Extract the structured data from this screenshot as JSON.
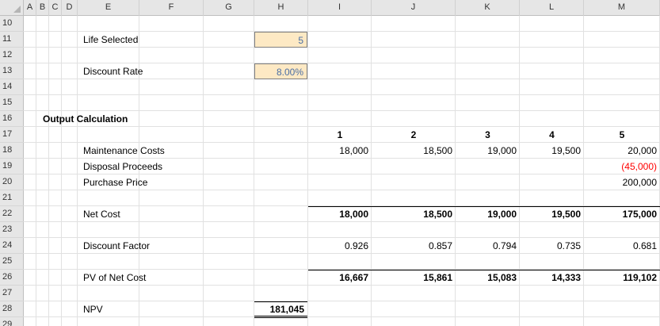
{
  "columns": [
    "A",
    "B",
    "C",
    "D",
    "E",
    "F",
    "G",
    "H",
    "I",
    "J",
    "K",
    "L",
    "M"
  ],
  "rows": [
    "10",
    "11",
    "12",
    "13",
    "14",
    "15",
    "16",
    "17",
    "18",
    "19",
    "20",
    "21",
    "22",
    "23",
    "24",
    "25",
    "26",
    "27",
    "28",
    "29"
  ],
  "inputs": {
    "life_label": "Life Selected",
    "life_value": "5",
    "rate_label": "Discount Rate",
    "rate_value": "8.00%"
  },
  "output": {
    "title": "Output Calculation",
    "years": [
      "1",
      "2",
      "3",
      "4",
      "5"
    ],
    "maintenance": {
      "label": "Maintenance Costs",
      "values": [
        "18,000",
        "18,500",
        "19,000",
        "19,500",
        "20,000"
      ]
    },
    "disposal": {
      "label": "Disposal Proceeds",
      "values": [
        "",
        "",
        "",
        "",
        "(45,000)"
      ]
    },
    "purchase": {
      "label": "Purchase Price",
      "values": [
        "",
        "",
        "",
        "",
        "200,000"
      ]
    },
    "net_cost": {
      "label": "Net Cost",
      "values": [
        "18,000",
        "18,500",
        "19,000",
        "19,500",
        "175,000"
      ]
    },
    "discount_factor": {
      "label": "Discount Factor",
      "values": [
        "0.926",
        "0.857",
        "0.794",
        "0.735",
        "0.681"
      ]
    },
    "pv_net_cost": {
      "label": "PV of Net Cost",
      "values": [
        "16,667",
        "15,861",
        "15,083",
        "14,333",
        "119,102"
      ]
    },
    "npv": {
      "label": "NPV",
      "value": "181,045"
    }
  },
  "colors": {
    "input_fill": "#fde9c4",
    "input_text": "#4a6fa5",
    "negative": "#ff0000"
  }
}
